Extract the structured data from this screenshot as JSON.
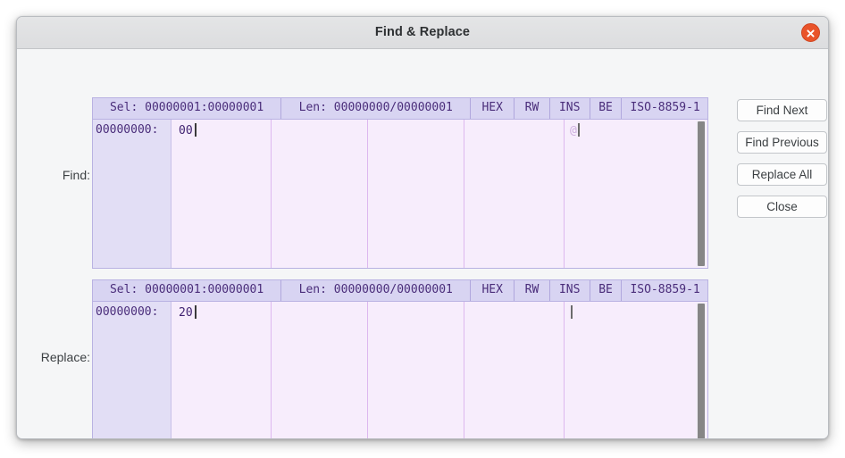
{
  "window": {
    "title": "Find & Replace",
    "close_icon": "close-icon"
  },
  "labels": {
    "find": "Find:",
    "replace": "Replace:"
  },
  "find_panel": {
    "header": {
      "selection": "Sel: 00000001:00000001",
      "length": "Len: 00000000/00000001",
      "mode": "HEX",
      "access": "RW",
      "insert": "INS",
      "endian": "BE",
      "encoding": "ISO-8859-1"
    },
    "offset": "00000000:",
    "hex_bytes": "00",
    "ascii": "@"
  },
  "replace_panel": {
    "header": {
      "selection": "Sel: 00000001:00000001",
      "length": "Len: 00000000/00000001",
      "mode": "HEX",
      "access": "RW",
      "insert": "INS",
      "endian": "BE",
      "encoding": "ISO-8859-1"
    },
    "offset": "00000000:",
    "hex_bytes": "20",
    "ascii": ""
  },
  "buttons": {
    "find_next": "Find Next",
    "find_previous": "Find Previous",
    "replace_all": "Replace All",
    "close": "Close"
  },
  "colors": {
    "header_bg": "#d8d4f2",
    "body_bg": "#f7edfc",
    "offset_bg": "#e2def5",
    "hex_text": "#4a2d7a",
    "close_button": "#e9542a",
    "dialog_bg": "#f5f6f7"
  }
}
